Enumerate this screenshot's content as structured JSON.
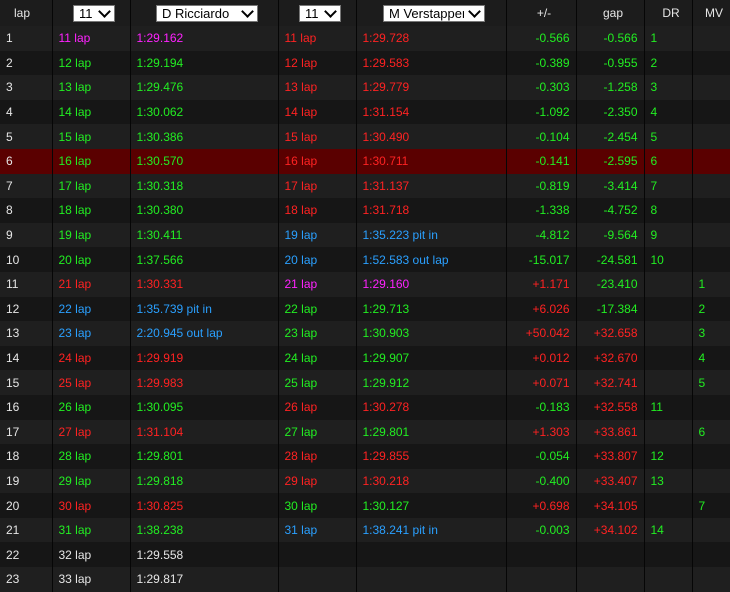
{
  "header": {
    "lap": "lap",
    "lap_select_a": "11",
    "driver_a": "D Ricciardo",
    "lap_select_b": "11",
    "driver_b": "M Verstappen",
    "delta": "+/-",
    "gap": "gap",
    "dr": "DR",
    "mv": "MV"
  },
  "colors": {
    "green": "#22ee22",
    "red": "#ff2222",
    "magenta": "#ff22ff",
    "blue": "#2aa0ff",
    "white": "#e6e6e6",
    "highlight_row": "#5a0000"
  },
  "rows": [
    {
      "lap": "1",
      "a_lap": "11 lap",
      "a_lap_c": "magenta",
      "a_time": "1:29.162",
      "a_time_c": "magenta",
      "b_lap": "11 lap",
      "b_lap_c": "red",
      "b_time": "1:29.728",
      "b_time_c": "red",
      "delta": "-0.566",
      "delta_c": "green",
      "gap": "-0.566",
      "gap_c": "green",
      "dr": "1",
      "mv": ""
    },
    {
      "lap": "2",
      "a_lap": "12 lap",
      "a_lap_c": "green",
      "a_time": "1:29.194",
      "a_time_c": "green",
      "b_lap": "12 lap",
      "b_lap_c": "red",
      "b_time": "1:29.583",
      "b_time_c": "red",
      "delta": "-0.389",
      "delta_c": "green",
      "gap": "-0.955",
      "gap_c": "green",
      "dr": "2",
      "mv": ""
    },
    {
      "lap": "3",
      "a_lap": "13 lap",
      "a_lap_c": "green",
      "a_time": "1:29.476",
      "a_time_c": "green",
      "b_lap": "13 lap",
      "b_lap_c": "red",
      "b_time": "1:29.779",
      "b_time_c": "red",
      "delta": "-0.303",
      "delta_c": "green",
      "gap": "-1.258",
      "gap_c": "green",
      "dr": "3",
      "mv": ""
    },
    {
      "lap": "4",
      "a_lap": "14 lap",
      "a_lap_c": "green",
      "a_time": "1:30.062",
      "a_time_c": "green",
      "b_lap": "14 lap",
      "b_lap_c": "red",
      "b_time": "1:31.154",
      "b_time_c": "red",
      "delta": "-1.092",
      "delta_c": "green",
      "gap": "-2.350",
      "gap_c": "green",
      "dr": "4",
      "mv": ""
    },
    {
      "lap": "5",
      "a_lap": "15 lap",
      "a_lap_c": "green",
      "a_time": "1:30.386",
      "a_time_c": "green",
      "b_lap": "15 lap",
      "b_lap_c": "red",
      "b_time": "1:30.490",
      "b_time_c": "red",
      "delta": "-0.104",
      "delta_c": "green",
      "gap": "-2.454",
      "gap_c": "green",
      "dr": "5",
      "mv": ""
    },
    {
      "lap": "6",
      "a_lap": "16 lap",
      "a_lap_c": "green",
      "a_time": "1:30.570",
      "a_time_c": "green",
      "b_lap": "16 lap",
      "b_lap_c": "red",
      "b_time": "1:30.711",
      "b_time_c": "red",
      "delta": "-0.141",
      "delta_c": "green",
      "gap": "-2.595",
      "gap_c": "green",
      "dr": "6",
      "mv": "",
      "highlight": true
    },
    {
      "lap": "7",
      "a_lap": "17 lap",
      "a_lap_c": "green",
      "a_time": "1:30.318",
      "a_time_c": "green",
      "b_lap": "17 lap",
      "b_lap_c": "red",
      "b_time": "1:31.137",
      "b_time_c": "red",
      "delta": "-0.819",
      "delta_c": "green",
      "gap": "-3.414",
      "gap_c": "green",
      "dr": "7",
      "mv": ""
    },
    {
      "lap": "8",
      "a_lap": "18 lap",
      "a_lap_c": "green",
      "a_time": "1:30.380",
      "a_time_c": "green",
      "b_lap": "18 lap",
      "b_lap_c": "red",
      "b_time": "1:31.718",
      "b_time_c": "red",
      "delta": "-1.338",
      "delta_c": "green",
      "gap": "-4.752",
      "gap_c": "green",
      "dr": "8",
      "mv": ""
    },
    {
      "lap": "9",
      "a_lap": "19 lap",
      "a_lap_c": "green",
      "a_time": "1:30.411",
      "a_time_c": "green",
      "b_lap": "19 lap",
      "b_lap_c": "blue",
      "b_time": "1:35.223 pit in",
      "b_time_c": "blue",
      "delta": "-4.812",
      "delta_c": "green",
      "gap": "-9.564",
      "gap_c": "green",
      "dr": "9",
      "mv": ""
    },
    {
      "lap": "10",
      "a_lap": "20 lap",
      "a_lap_c": "green",
      "a_time": "1:37.566",
      "a_time_c": "green",
      "b_lap": "20 lap",
      "b_lap_c": "blue",
      "b_time": "1:52.583 out lap",
      "b_time_c": "blue",
      "delta": "-15.017",
      "delta_c": "green",
      "gap": "-24.581",
      "gap_c": "green",
      "dr": "10",
      "mv": ""
    },
    {
      "lap": "11",
      "a_lap": "21 lap",
      "a_lap_c": "red",
      "a_time": "1:30.331",
      "a_time_c": "red",
      "b_lap": "21 lap",
      "b_lap_c": "magenta",
      "b_time": "1:29.160",
      "b_time_c": "magenta",
      "delta": "+1.171",
      "delta_c": "red",
      "gap": "-23.410",
      "gap_c": "green",
      "dr": "",
      "mv": "1"
    },
    {
      "lap": "12",
      "a_lap": "22 lap",
      "a_lap_c": "blue",
      "a_time": "1:35.739 pit in",
      "a_time_c": "blue",
      "b_lap": "22 lap",
      "b_lap_c": "green",
      "b_time": "1:29.713",
      "b_time_c": "green",
      "delta": "+6.026",
      "delta_c": "red",
      "gap": "-17.384",
      "gap_c": "green",
      "dr": "",
      "mv": "2"
    },
    {
      "lap": "13",
      "a_lap": "23 lap",
      "a_lap_c": "blue",
      "a_time": "2:20.945 out lap",
      "a_time_c": "blue",
      "b_lap": "23 lap",
      "b_lap_c": "green",
      "b_time": "1:30.903",
      "b_time_c": "green",
      "delta": "+50.042",
      "delta_c": "red",
      "gap": "+32.658",
      "gap_c": "red",
      "dr": "",
      "mv": "3"
    },
    {
      "lap": "14",
      "a_lap": "24 lap",
      "a_lap_c": "red",
      "a_time": "1:29.919",
      "a_time_c": "red",
      "b_lap": "24 lap",
      "b_lap_c": "green",
      "b_time": "1:29.907",
      "b_time_c": "green",
      "delta": "+0.012",
      "delta_c": "red",
      "gap": "+32.670",
      "gap_c": "red",
      "dr": "",
      "mv": "4"
    },
    {
      "lap": "15",
      "a_lap": "25 lap",
      "a_lap_c": "red",
      "a_time": "1:29.983",
      "a_time_c": "red",
      "b_lap": "25 lap",
      "b_lap_c": "green",
      "b_time": "1:29.912",
      "b_time_c": "green",
      "delta": "+0.071",
      "delta_c": "red",
      "gap": "+32.741",
      "gap_c": "red",
      "dr": "",
      "mv": "5"
    },
    {
      "lap": "16",
      "a_lap": "26 lap",
      "a_lap_c": "green",
      "a_time": "1:30.095",
      "a_time_c": "green",
      "b_lap": "26 lap",
      "b_lap_c": "red",
      "b_time": "1:30.278",
      "b_time_c": "red",
      "delta": "-0.183",
      "delta_c": "green",
      "gap": "+32.558",
      "gap_c": "red",
      "dr": "11",
      "mv": ""
    },
    {
      "lap": "17",
      "a_lap": "27 lap",
      "a_lap_c": "red",
      "a_time": "1:31.104",
      "a_time_c": "red",
      "b_lap": "27 lap",
      "b_lap_c": "green",
      "b_time": "1:29.801",
      "b_time_c": "green",
      "delta": "+1.303",
      "delta_c": "red",
      "gap": "+33.861",
      "gap_c": "red",
      "dr": "",
      "mv": "6"
    },
    {
      "lap": "18",
      "a_lap": "28 lap",
      "a_lap_c": "green",
      "a_time": "1:29.801",
      "a_time_c": "green",
      "b_lap": "28 lap",
      "b_lap_c": "red",
      "b_time": "1:29.855",
      "b_time_c": "red",
      "delta": "-0.054",
      "delta_c": "green",
      "gap": "+33.807",
      "gap_c": "red",
      "dr": "12",
      "mv": ""
    },
    {
      "lap": "19",
      "a_lap": "29 lap",
      "a_lap_c": "green",
      "a_time": "1:29.818",
      "a_time_c": "green",
      "b_lap": "29 lap",
      "b_lap_c": "red",
      "b_time": "1:30.218",
      "b_time_c": "red",
      "delta": "-0.400",
      "delta_c": "green",
      "gap": "+33.407",
      "gap_c": "red",
      "dr": "13",
      "mv": ""
    },
    {
      "lap": "20",
      "a_lap": "30 lap",
      "a_lap_c": "red",
      "a_time": "1:30.825",
      "a_time_c": "red",
      "b_lap": "30 lap",
      "b_lap_c": "green",
      "b_time": "1:30.127",
      "b_time_c": "green",
      "delta": "+0.698",
      "delta_c": "red",
      "gap": "+34.105",
      "gap_c": "red",
      "dr": "",
      "mv": "7"
    },
    {
      "lap": "21",
      "a_lap": "31 lap",
      "a_lap_c": "green",
      "a_time": "1:38.238",
      "a_time_c": "green",
      "b_lap": "31 lap",
      "b_lap_c": "blue",
      "b_time": "1:38.241 pit in",
      "b_time_c": "blue",
      "delta": "-0.003",
      "delta_c": "green",
      "gap": "+34.102",
      "gap_c": "red",
      "dr": "14",
      "mv": ""
    },
    {
      "lap": "22",
      "a_lap": "32 lap",
      "a_lap_c": "white",
      "a_time": "1:29.558",
      "a_time_c": "white",
      "b_lap": "",
      "b_lap_c": "white",
      "b_time": "",
      "b_time_c": "white",
      "delta": "",
      "delta_c": "white",
      "gap": "",
      "gap_c": "white",
      "dr": "",
      "mv": ""
    },
    {
      "lap": "23",
      "a_lap": "33 lap",
      "a_lap_c": "white",
      "a_time": "1:29.817",
      "a_time_c": "white",
      "b_lap": "",
      "b_lap_c": "white",
      "b_time": "",
      "b_time_c": "white",
      "delta": "",
      "delta_c": "white",
      "gap": "",
      "gap_c": "white",
      "dr": "",
      "mv": ""
    }
  ]
}
